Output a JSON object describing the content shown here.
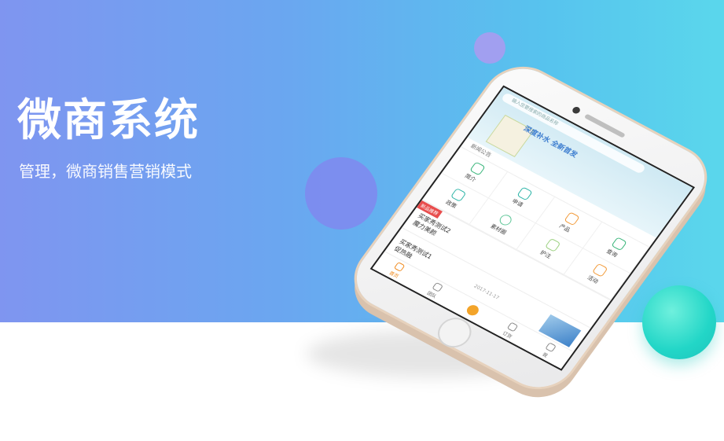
{
  "hero": {
    "title": "微商系统",
    "subtitle": "管理，微商销售营销模式"
  },
  "phone": {
    "search_placeholder": "输入您要搜索的商品名称",
    "banner_text": "深度补水 全新首发",
    "notice_label": "新闻公告",
    "grid_items": [
      {
        "label": "简介",
        "icon": "home-icon"
      },
      {
        "label": "申请",
        "icon": "user-icon"
      },
      {
        "label": "产品",
        "icon": "box-icon"
      },
      {
        "label": "查询",
        "icon": "search-user-icon"
      },
      {
        "label": "政策",
        "icon": "document-icon"
      },
      {
        "label": "素材圈",
        "icon": "flower-icon"
      },
      {
        "label": "护注",
        "icon": "heart-icon"
      },
      {
        "label": "活动",
        "icon": "gift-icon"
      }
    ],
    "articles": [
      {
        "tag": "新品推荐",
        "title": "买家秀测试2",
        "subtitle": "魔力美颜",
        "date": ""
      },
      {
        "tag": "",
        "title": "买家秀测试1",
        "subtitle": "促热融",
        "date": "2017-11-17"
      },
      {
        "tag": "",
        "title": "",
        "subtitle": "",
        "date": "2017-11-17"
      }
    ],
    "tabs": [
      {
        "label": "首页",
        "icon": "home-icon"
      },
      {
        "label": "团队",
        "icon": "team-icon"
      },
      {
        "label": "",
        "icon": "center-icon"
      },
      {
        "label": "订货",
        "icon": "cart-icon"
      },
      {
        "label": "我",
        "icon": "profile-icon"
      }
    ]
  },
  "colors": {
    "gradient_start": "#7f95f0",
    "gradient_end": "#5ad7ec",
    "accent_orange": "#f08a1d",
    "accent_teal": "#22d6c7"
  }
}
